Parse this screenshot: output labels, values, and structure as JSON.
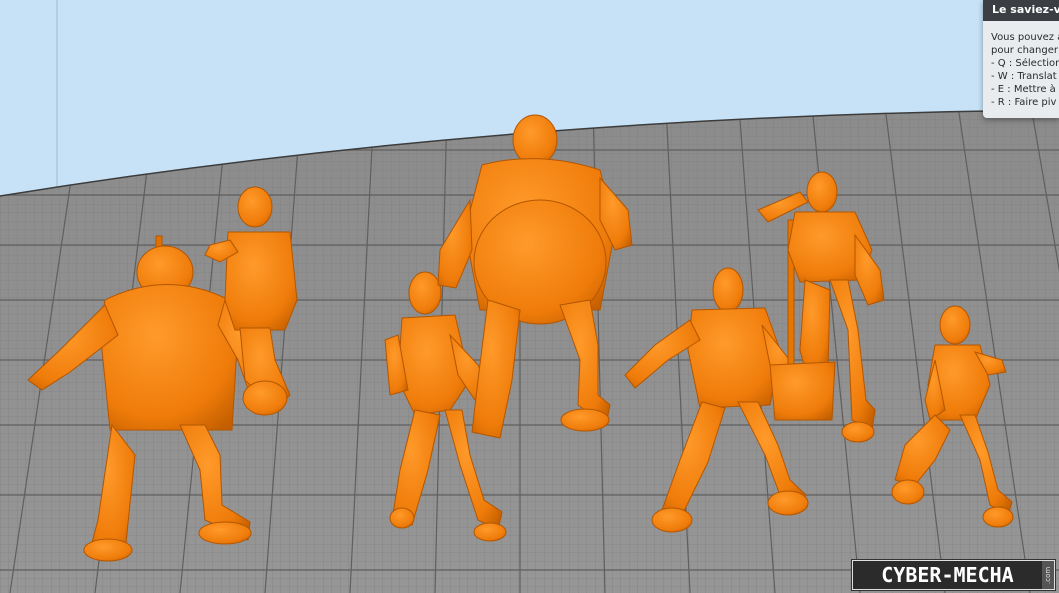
{
  "tip": {
    "title": "Le saviez-v",
    "lines": [
      "Vous pouvez a",
      "pour changer",
      "- Q : Sélection",
      "- W : Translat",
      "- E : Mettre à",
      "- R : Faire piv"
    ]
  },
  "watermark": {
    "text": "CYBER-MECHA",
    "suffix": ".com"
  },
  "scene": {
    "background_color": "#c7e2f6",
    "bed_color": "#8f8f8f",
    "grid_color": "#7a7a7a",
    "model_color": "#f5830f",
    "model_shadow": "#c25e00",
    "models": [
      "punk-zombie-model",
      "crawling-zombie-model",
      "zombie-teen-model",
      "fat-zombie-model",
      "zombie-walker-model",
      "janitor-zombie-model",
      "zombie-woman-model"
    ]
  }
}
